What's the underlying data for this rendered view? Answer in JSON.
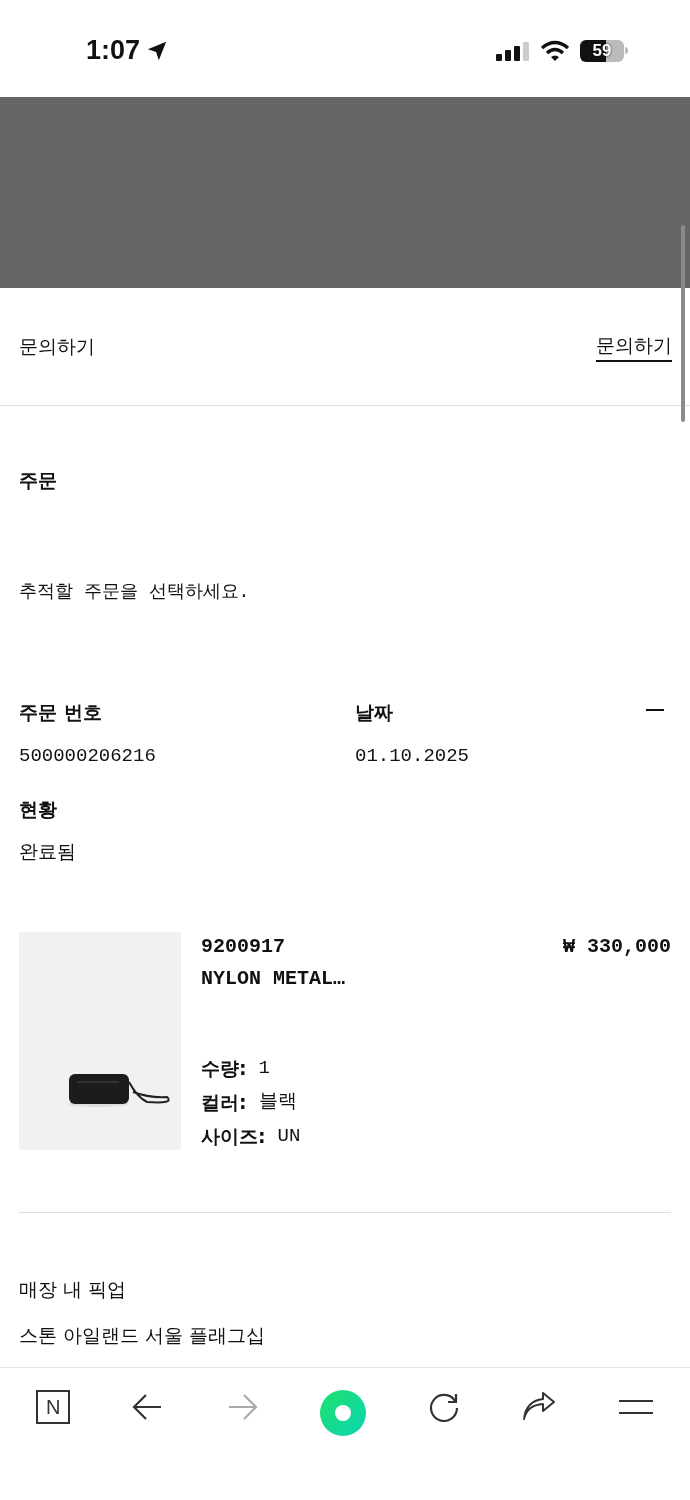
{
  "status_bar": {
    "time": "1:07",
    "battery": "59"
  },
  "inquiry": {
    "title": "문의하기",
    "link": "문의하기"
  },
  "order_section": {
    "title": "주문",
    "prompt": "추적할 주문을 선택하세요."
  },
  "order": {
    "number_label": "주문 번호",
    "number": "500000206216",
    "date_label": "날짜",
    "date": "01.10.2025",
    "expanded": true,
    "status_label": "현황",
    "status": "완료됨"
  },
  "item": {
    "code": "9200917",
    "name": "NYLON METAL…",
    "price": "₩ 330,000",
    "details": [
      {
        "label": "수량:",
        "value": "1"
      },
      {
        "label": "컬러:",
        "value": "블랙"
      },
      {
        "label": "사이즈:",
        "value": "UN"
      }
    ]
  },
  "pickup": {
    "title": "매장 내 픽업",
    "store": "스톤 아일랜드 서울 플래그십"
  },
  "toolbar": {
    "logo": "N",
    "forward_disabled": true
  }
}
